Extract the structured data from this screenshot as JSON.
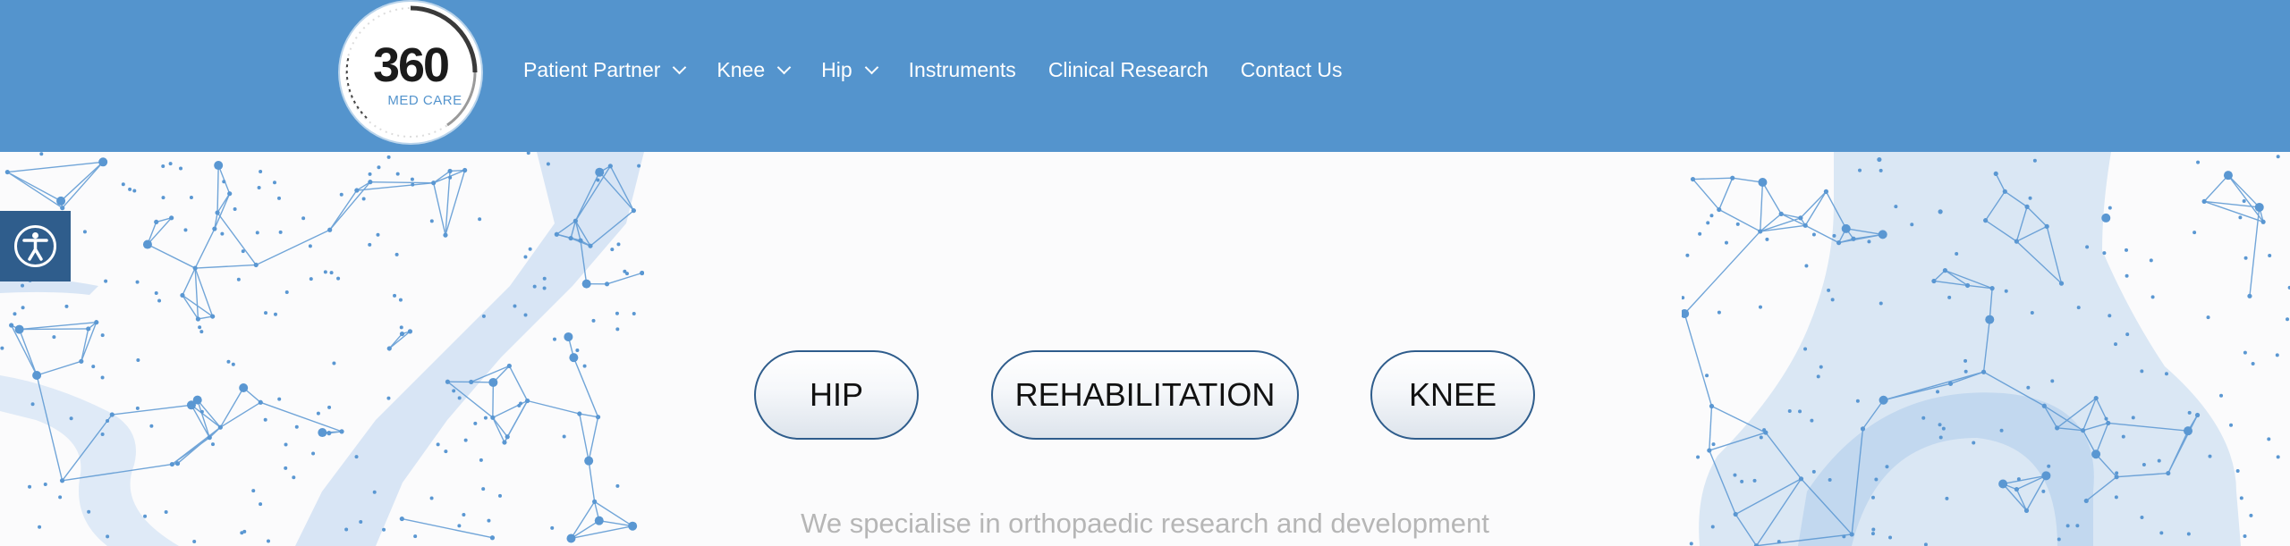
{
  "logo": {
    "number": "360",
    "subtitle": "MED CARE"
  },
  "nav": {
    "items": [
      {
        "label": "Patient Partner",
        "has_dropdown": true
      },
      {
        "label": "Knee",
        "has_dropdown": true
      },
      {
        "label": "Hip",
        "has_dropdown": true
      },
      {
        "label": "Instruments",
        "has_dropdown": false
      },
      {
        "label": "Clinical Research",
        "has_dropdown": false
      },
      {
        "label": "Contact Us",
        "has_dropdown": false
      }
    ]
  },
  "accessibility": {
    "icon": "accessibility-icon"
  },
  "buttons": {
    "hip": "HIP",
    "rehabilitation": "REHABILITATION",
    "knee": "KNEE"
  },
  "tagline": "We specialise in orthopaedic research and development",
  "colors": {
    "header_bg": "#5494cd",
    "accessibility_bg": "#2f5d8c",
    "pill_border": "#2f5d8c",
    "mesh": "#5a97d2",
    "tagline": "#b6b6b6"
  }
}
